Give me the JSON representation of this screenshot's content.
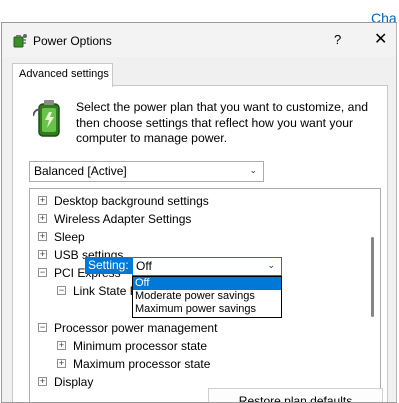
{
  "background": {
    "link_text": "Cha"
  },
  "window": {
    "title": "Power Options",
    "help_glyph": "?",
    "close_glyph": "✕",
    "tab_label": "Advanced settings",
    "description": "Select the power plan that you want to customize, and then choose settings that reflect how you want your computer to manage power.",
    "plan_select_value": "Balanced [Active]",
    "tree": [
      {
        "label": "Desktop background settings",
        "expander": "+"
      },
      {
        "label": "Wireless Adapter Settings",
        "expander": "+"
      },
      {
        "label": "Sleep",
        "expander": "+"
      },
      {
        "label": "USB settings",
        "expander": "+"
      },
      {
        "label": "PCI Express",
        "expander": "−"
      },
      {
        "label": "Link State Power Management",
        "expander": "−"
      },
      {
        "label": "Processor power management",
        "expander": "−"
      },
      {
        "label": "Minimum processor state",
        "expander": "+"
      },
      {
        "label": "Maximum processor state",
        "expander": "+"
      },
      {
        "label": "Display",
        "expander": "+"
      }
    ],
    "setting_label": "Setting:",
    "setting_value": "Off",
    "dropdown_options": [
      "Off",
      "Moderate power savings",
      "Maximum power savings"
    ],
    "restore_button": "Restore plan defaults"
  },
  "colors": {
    "accent": "#0078d7",
    "link": "#0067c0"
  },
  "icons": {
    "app": "power-options-icon",
    "battery": "battery-plug-icon",
    "chevron": "chevron-down-icon"
  }
}
